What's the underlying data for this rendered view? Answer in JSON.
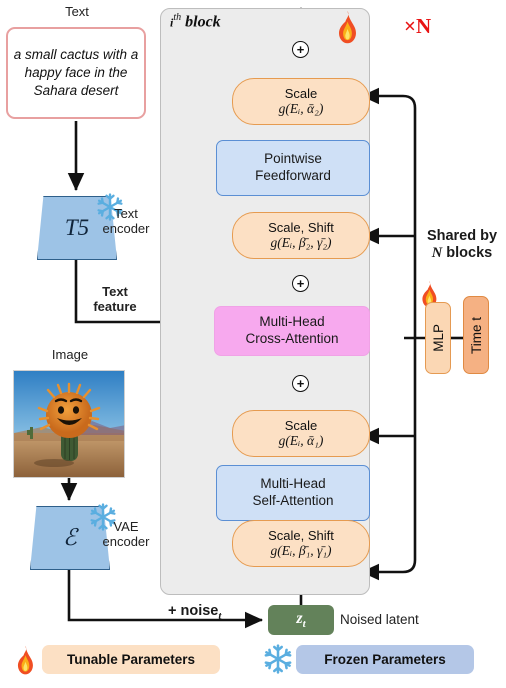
{
  "diagram": {
    "title_block": "block",
    "title_block_sup": "th",
    "repeat_label": "×N",
    "repeat_count": "N"
  },
  "inputs": {
    "text_label": "Text",
    "prompt": "a small cactus with a happy face in the Sahara desert",
    "image_label": "Image",
    "image_description": "a small cactus with a happy smiling face standing in a sunny desert landscape"
  },
  "encoders": {
    "text_encoder_symbol": "T5",
    "text_encoder_label": "Text encoder",
    "text_feature_label": "Text feature",
    "vae_encoder_symbol": "ℰ",
    "vae_encoder_label": "VAE encoder"
  },
  "latent": {
    "noise_label": "+ noise",
    "noise_sub": "t",
    "zt_symbol": "z",
    "zt_sub": "t",
    "noised_latent_label": "Noised latent"
  },
  "block_modules": [
    {
      "id": "scale-2",
      "line1": "Scale",
      "line2": "g(Eᵢ, ᾱ₂)",
      "kind": "pill"
    },
    {
      "id": "pointwise-ff",
      "line1": "Pointwise",
      "line2": "Feedforward",
      "kind": "blue"
    },
    {
      "id": "scale-shift-2",
      "line1": "Scale, Shift",
      "line2": "g(Eᵢ, β̄₂, γ̄₂)",
      "kind": "pill"
    },
    {
      "id": "cross-attn",
      "line1": "Multi-Head",
      "line2": "Cross-Attention",
      "kind": "pink"
    },
    {
      "id": "scale-1",
      "line1": "Scale",
      "line2": "g(Eᵢ, ᾱ₁)",
      "kind": "pill"
    },
    {
      "id": "self-attn",
      "line1": "Multi-Head",
      "line2": "Self-Attention",
      "kind": "blue"
    },
    {
      "id": "scale-shift-1",
      "line1": "Scale, Shift",
      "line2": "g(Eᵢ, β̄₁, γ̄₁)",
      "kind": "pill"
    }
  ],
  "adders": {
    "symbol": "+",
    "count": 3
  },
  "shared": {
    "heading_line1": "Shared by",
    "heading_line2_n": "N",
    "heading_line2_rest": "blocks",
    "mlp_label": "MLP",
    "time_label": "Time t"
  },
  "legend": {
    "tunable_label": "Tunable Parameters",
    "frozen_label": "Frozen Parameters",
    "flame_icon": "flame-icon",
    "snowflake_icon": "snowflake-icon"
  },
  "colors": {
    "tunable_orange": "#FCE0C4",
    "tunable_orange_border": "#E69B50",
    "frozen_blue": "#B4C7E7",
    "attention_blue": "#CFE0F6",
    "cross_attention_pink": "#F7A9EE",
    "latent_green": "#63825A",
    "prompt_border_red": "#E8A0A0",
    "repeat_red": "#E81313",
    "block_background": "#ECECEC",
    "time_orange": "#F5B183",
    "mlp_orange": "#FBD7B4"
  }
}
